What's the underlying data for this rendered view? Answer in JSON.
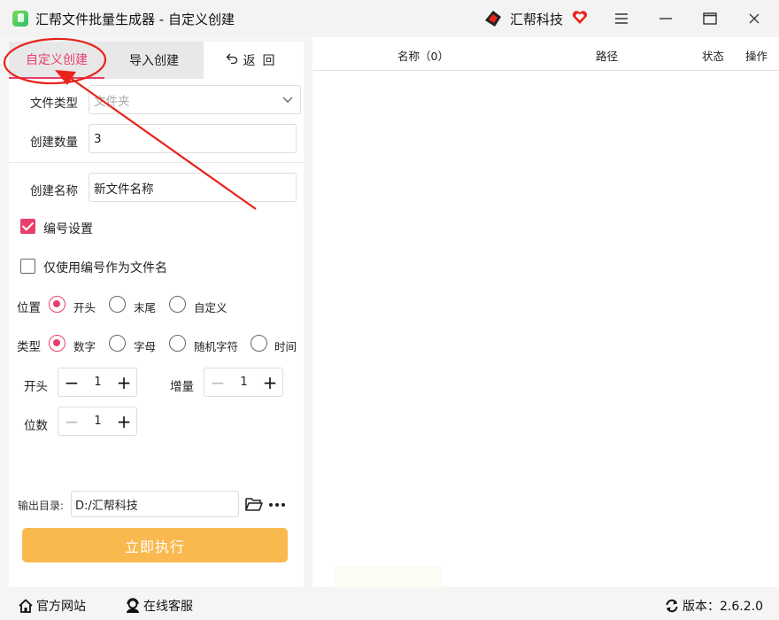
{
  "window": {
    "title": "汇帮文件批量生成器 - 自定义创建",
    "brand": "汇帮科技"
  },
  "tabs": [
    {
      "label": "自定义创建",
      "active": true
    },
    {
      "label": "导入创建",
      "active": false
    },
    {
      "label": "返回",
      "active": false
    }
  ],
  "form": {
    "file_type_label": "文件类型",
    "file_type_value": "文件夹",
    "count_label": "创建数量",
    "count_value": "3",
    "name_label": "创建名称",
    "name_value": "新文件名称"
  },
  "numbering": {
    "enabled_label": "编号设置",
    "enabled": true,
    "only_number_label": "仅使用编号作为文件名",
    "only_number": false,
    "position_label": "位置",
    "position_options": [
      "开头",
      "末尾",
      "自定义"
    ],
    "position_selected": "开头",
    "type_label": "类型",
    "type_options": [
      "数字",
      "字母",
      "随机字符",
      "时间"
    ],
    "type_selected": "数字",
    "start_label": "开头",
    "start_value": "1",
    "increment_label": "增量",
    "increment_value": "1",
    "digits_label": "位数",
    "digits_value": "1"
  },
  "output": {
    "label": "输出目录:",
    "path": "D:/汇帮科技"
  },
  "execute_label": "立即执行",
  "table": {
    "columns": [
      "名称（0）",
      "路径",
      "状态",
      "操作"
    ],
    "rows": []
  },
  "footer": {
    "website_label": "官方网站",
    "support_label": "在线客服",
    "version_label": "版本：2.6.2.0"
  },
  "colors": {
    "accent": "#e83e6c",
    "execute_button": "#f9b94e",
    "annotation": "#e8231b"
  },
  "icons": [
    "app-icon",
    "brand-logo-icon",
    "heart-icon",
    "menu-icon",
    "minimize-icon",
    "maximize-icon",
    "close-icon",
    "back-arrow-icon",
    "chevron-down-icon",
    "folder-icon",
    "more-icon",
    "home-icon",
    "support-icon",
    "refresh-icon"
  ]
}
